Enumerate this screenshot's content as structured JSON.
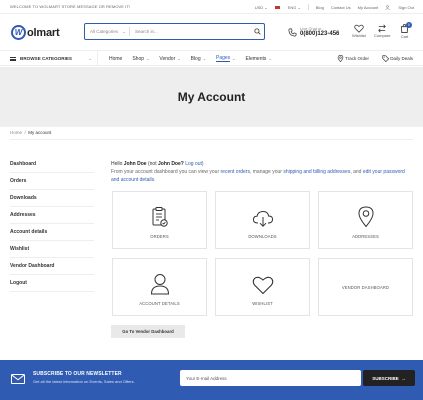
{
  "topbar": {
    "welcome": "WELCOME TO WOLMART STORE MESSAGE OR REMOVE IT!",
    "currency": "USD",
    "language": "ENG",
    "links": [
      "Blog",
      "Contact Us",
      "My Account"
    ],
    "signin": "Sign Out"
  },
  "header": {
    "logo_mark": "W",
    "logo_text": "olmart",
    "search_category": "All Categories",
    "search_placeholder": "Search in...",
    "phone_label": "Live Chat or :",
    "phone_number": "0(800)123-456",
    "wishlist_label": "Wishlist",
    "compare_label": "Compare",
    "cart_label": "Cart",
    "cart_count": "0"
  },
  "nav": {
    "browse": "BROWSE CATEGORIES",
    "links": [
      {
        "label": "Home"
      },
      {
        "label": "Shop"
      },
      {
        "label": "Vendor"
      },
      {
        "label": "Blog"
      },
      {
        "label": "Pages"
      },
      {
        "label": "Elements"
      }
    ],
    "track_order": "Track Order",
    "daily_deals": "Daily Deals"
  },
  "banner": {
    "title": "My Account"
  },
  "breadcrumb": {
    "home": "Home",
    "current": "My account"
  },
  "sidebar": {
    "items": [
      "Dashboard",
      "Orders",
      "Downloads",
      "Addresses",
      "Account details",
      "Wishlist",
      "Vendor Dashboard",
      "Logout"
    ]
  },
  "content": {
    "hello_prefix": "Hello",
    "user": "John Doe",
    "not_prefix": "(not",
    "user2": "John Doe?",
    "logout": "Log out)",
    "p1": "From your account dashboard you can view your",
    "recent_orders": "recent orders",
    "p2": ", manage your",
    "addresses": "shipping and billing addresses",
    "p3": ", and",
    "edit": "edit your password and account details",
    "p4": "."
  },
  "tiles": [
    {
      "label": "ORDERS",
      "icon": "orders-icon"
    },
    {
      "label": "DOWNLOADS",
      "icon": "download-icon"
    },
    {
      "label": "ADDRESSES",
      "icon": "map-pin-icon"
    },
    {
      "label": "ACCOUNT DETAILS",
      "icon": "user-icon"
    },
    {
      "label": "WISHLIST",
      "icon": "heart-icon"
    },
    {
      "label": "VENDOR DASHBOARD",
      "icon": ""
    }
  ],
  "vendor_button": "Go To Vendor Dashboard",
  "newsletter": {
    "title": "SUBSCRIBE TO OUR NEWSLETTER",
    "subtitle": "Get all the latest information on Events, Sales and Offers.",
    "placeholder": "Your E-mail Address",
    "button": "SUBSCRIBE"
  },
  "colors": {
    "accent": "#2f5bb3",
    "banner": "#eeeeee",
    "dark": "#222222"
  }
}
